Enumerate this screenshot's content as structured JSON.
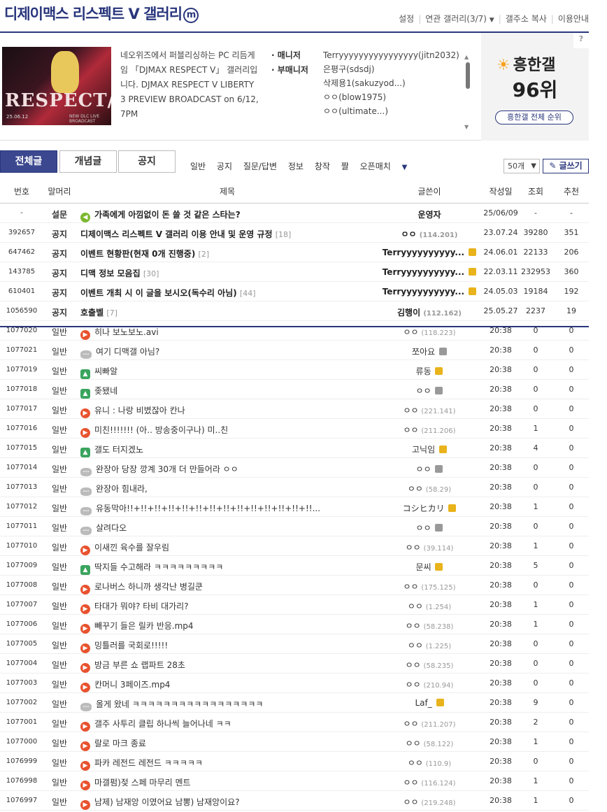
{
  "header": {
    "title": "디제이맥스 리스펙트 V 갤러리",
    "title_badge": "m",
    "links": [
      "설정",
      "연관 갤러리(3/7)",
      "갤주소 복사",
      "이용안내"
    ]
  },
  "info": {
    "thumb_text": "RESPECT/V",
    "thumb_small": "25.06.12",
    "thumb_small2": "NEW DLC LIVE BROADCAST",
    "desc": "네오위즈에서 퍼블리싱하는 PC 리듬게임 「DJMAX RESPECT V」 갤러리입니다. DJMAX RESPECT V LIBERTY 3 PREVIEW BROADCAST on 6/12, 7PM",
    "manager_label": "· 매니저",
    "submanager_label": "· 부매니저",
    "manager": "Terryyyyyyyyyyyyyyyy(jitn2032)",
    "submanagers": [
      "은평구(sdsdj)",
      "삭제용1(sakuzyod...)",
      "ㅇㅇ(blow1975)",
      "ㅇㅇ(ultimate...)"
    ]
  },
  "rank": {
    "help": "?",
    "label": "흥한갤",
    "value": "96위",
    "button": "흥한갤 전체 순위"
  },
  "tabs": [
    "전체글",
    "개념글",
    "공지"
  ],
  "heads": [
    "일반",
    "공지",
    "질문/답변",
    "정보",
    "창작",
    "짤",
    "오픈매치"
  ],
  "per_page": "50개",
  "write_button": "글쓰기",
  "columns": [
    "번호",
    "말머리",
    "제목",
    "글쓴이",
    "작성일",
    "조회",
    "추천"
  ],
  "rows": [
    {
      "num": "-",
      "head": "설문",
      "icon": "spk",
      "title": "가족에게 아낌없이 돈 쓸 것 같은 스타는?",
      "cnt": "",
      "writer": "운영자",
      "ip": "",
      "badge": "",
      "date": "25/06/09",
      "views": "-",
      "rec": "-",
      "notice": true
    },
    {
      "num": "392657",
      "head": "공지",
      "icon": "info",
      "title": "디제이맥스 리스펙트 V 갤러리 이용 안내 및 운영 규정",
      "cnt": "[18]",
      "writer": "ㅇㅇ",
      "ip": "(114.201)",
      "badge": "",
      "date": "23.07.24",
      "views": "39280",
      "rec": "351",
      "notice": true
    },
    {
      "num": "647462",
      "head": "공지",
      "icon": "info",
      "title": "이벤트 현황판(현재 0개 진행중)",
      "cnt": "[2]",
      "writer": "Terryyyyyyyyyy...",
      "ip": "",
      "badge": "lock",
      "date": "24.06.01",
      "views": "22133",
      "rec": "206",
      "notice": true
    },
    {
      "num": "143785",
      "head": "공지",
      "icon": "info",
      "title": "디맥 정보 모음집",
      "cnt": "[30]",
      "writer": "Terryyyyyyyyyy...",
      "ip": "",
      "badge": "lock",
      "date": "22.03.11",
      "views": "232953",
      "rec": "360",
      "notice": true
    },
    {
      "num": "610401",
      "head": "공지",
      "icon": "info",
      "title": "이벤트 개최 시 이 글을 보시오(독수리 아님)",
      "cnt": "[44]",
      "writer": "Terryyyyyyyyyy...",
      "ip": "",
      "badge": "lock",
      "date": "24.05.03",
      "views": "19184",
      "rec": "192",
      "notice": true
    },
    {
      "num": "1056590",
      "head": "공지",
      "icon": "info",
      "title": "호출벨",
      "cnt": "[7]",
      "writer": "김행이",
      "ip": "(112.162)",
      "badge": "",
      "date": "25.05.27",
      "views": "2237",
      "rec": "19",
      "notice": true
    },
    {
      "num": "1077020",
      "head": "일반",
      "icon": "vid",
      "title": "히나 보노보노.avi",
      "cnt": "",
      "writer": "ㅇㅇ",
      "ip": "(118.223)",
      "badge": "",
      "date": "20:38",
      "views": "0",
      "rec": "0"
    },
    {
      "num": "1077021",
      "head": "일반",
      "icon": "txt",
      "title": "여기 디맥갤 아님?",
      "cnt": "",
      "writer": "쪼아요",
      "ip": "",
      "badge": "fix",
      "date": "20:38",
      "views": "0",
      "rec": "0"
    },
    {
      "num": "1077019",
      "head": "일반",
      "icon": "img",
      "title": "씨빠알",
      "cnt": "",
      "writer": "류동",
      "ip": "",
      "badge": "lock",
      "date": "20:38",
      "views": "0",
      "rec": "0"
    },
    {
      "num": "1077018",
      "head": "일반",
      "icon": "img",
      "title": "좆됐네",
      "cnt": "",
      "writer": "ㅇㅇ",
      "ip": "",
      "badge": "fix",
      "date": "20:38",
      "views": "0",
      "rec": "0"
    },
    {
      "num": "1077017",
      "head": "일반",
      "icon": "vid",
      "title": "유니 : 나랑 비볐잖아 칸나",
      "cnt": "",
      "writer": "ㅇㅇ",
      "ip": "(221.141)",
      "badge": "",
      "date": "20:38",
      "views": "0",
      "rec": "0"
    },
    {
      "num": "1077016",
      "head": "일반",
      "icon": "vid",
      "title": "미친!!!!!!! (아.. 방송중이구나) 미..친",
      "cnt": "",
      "writer": "ㅇㅇ",
      "ip": "(211.206)",
      "badge": "",
      "date": "20:38",
      "views": "1",
      "rec": "0"
    },
    {
      "num": "1077015",
      "head": "일반",
      "icon": "img",
      "title": "갤도 터지겠노",
      "cnt": "",
      "writer": "고닉임",
      "ip": "",
      "badge": "lock",
      "date": "20:38",
      "views": "4",
      "rec": "0"
    },
    {
      "num": "1077014",
      "head": "일반",
      "icon": "txt",
      "title": "완장아 당장 깡계 30개 더 만들어라 ㅇㅇ",
      "cnt": "",
      "writer": "ㅇㅇ",
      "ip": "",
      "badge": "fix",
      "date": "20:38",
      "views": "0",
      "rec": "0"
    },
    {
      "num": "1077013",
      "head": "일반",
      "icon": "txt",
      "title": "완장아 힘내라,",
      "cnt": "",
      "writer": "ㅇㅇ",
      "ip": "(58.29)",
      "badge": "",
      "date": "20:38",
      "views": "0",
      "rec": "0"
    },
    {
      "num": "1077012",
      "head": "일반",
      "icon": "txt",
      "title": "유동막아!!+!!+!!+!!+!!+!!+!!+!!+!!+!!+!!+!!+!!+!!...",
      "cnt": "",
      "writer": "コシヒカリ",
      "ip": "",
      "badge": "lock",
      "date": "20:38",
      "views": "1",
      "rec": "0"
    },
    {
      "num": "1077011",
      "head": "일반",
      "icon": "txt",
      "title": "살려다오",
      "cnt": "",
      "writer": "ㅇㅇ",
      "ip": "",
      "badge": "fix",
      "date": "20:38",
      "views": "0",
      "rec": "0"
    },
    {
      "num": "1077010",
      "head": "일반",
      "icon": "vid",
      "title": "이새낀 육수를 잘우림",
      "cnt": "",
      "writer": "ㅇㅇ",
      "ip": "(39.114)",
      "badge": "",
      "date": "20:38",
      "views": "1",
      "rec": "0"
    },
    {
      "num": "1077009",
      "head": "일반",
      "icon": "img",
      "title": "딱지들 수고해라 ㅋㅋㅋㅋㅋㅋㅋㅋㅋ",
      "cnt": "",
      "writer": "문씨",
      "ip": "",
      "badge": "lock",
      "date": "20:38",
      "views": "5",
      "rec": "0"
    },
    {
      "num": "1077008",
      "head": "일반",
      "icon": "vid",
      "title": "로나버스 하니까 생각난 병길쿤",
      "cnt": "",
      "writer": "ㅇㅇ",
      "ip": "(175.125)",
      "badge": "",
      "date": "20:38",
      "views": "0",
      "rec": "0"
    },
    {
      "num": "1077007",
      "head": "일반",
      "icon": "vid",
      "title": "타대가 뭐야? 타비 대가리?",
      "cnt": "",
      "writer": "ㅇㅇ",
      "ip": "(1.254)",
      "badge": "",
      "date": "20:38",
      "views": "1",
      "rec": "0"
    },
    {
      "num": "1077006",
      "head": "일반",
      "icon": "vid",
      "title": "빼꾸기 들은 릴카 반응.mp4",
      "cnt": "",
      "writer": "ㅇㅇ",
      "ip": "(58.238)",
      "badge": "",
      "date": "20:38",
      "views": "1",
      "rec": "0"
    },
    {
      "num": "1077005",
      "head": "일반",
      "icon": "vid",
      "title": "밍틀러를 국회로!!!!!",
      "cnt": "",
      "writer": "ㅇㅇ",
      "ip": "(1.225)",
      "badge": "",
      "date": "20:38",
      "views": "0",
      "rec": "0"
    },
    {
      "num": "1077004",
      "head": "일반",
      "icon": "vid",
      "title": "방금 부른 쇼 랩파트 28초",
      "cnt": "",
      "writer": "ㅇㅇ",
      "ip": "(58.235)",
      "badge": "",
      "date": "20:38",
      "views": "0",
      "rec": "0"
    },
    {
      "num": "1077003",
      "head": "일반",
      "icon": "vid",
      "title": "칸머니 3페이즈.mp4",
      "cnt": "",
      "writer": "ㅇㅇ",
      "ip": "(210.94)",
      "badge": "",
      "date": "20:38",
      "views": "0",
      "rec": "0"
    },
    {
      "num": "1077002",
      "head": "일반",
      "icon": "txt",
      "title": "올게 왔네 ㅋㅋㅋㅋㅋㅋㅋㅋㅋㅋㅋㅋㅋㅋㅋㅋㅋ",
      "cnt": "",
      "writer": "Laf_",
      "ip": "",
      "badge": "lock",
      "date": "20:38",
      "views": "9",
      "rec": "0"
    },
    {
      "num": "1077001",
      "head": "일반",
      "icon": "vid",
      "title": "갤주 사투리 클립 하나씩 늘어나네 ㅋㅋ",
      "cnt": "",
      "writer": "ㅇㅇ",
      "ip": "(211.207)",
      "badge": "",
      "date": "20:38",
      "views": "2",
      "rec": "0"
    },
    {
      "num": "1077000",
      "head": "일반",
      "icon": "vid",
      "title": "랄로 마크 종료",
      "cnt": "",
      "writer": "ㅇㅇ",
      "ip": "(58.122)",
      "badge": "",
      "date": "20:38",
      "views": "1",
      "rec": "0"
    },
    {
      "num": "1076999",
      "head": "일반",
      "icon": "vid",
      "title": "파카 레전드 레전드 ㅋㅋㅋㅋㅋ",
      "cnt": "",
      "writer": "ㅇㅇ",
      "ip": "(110.9)",
      "badge": "",
      "date": "20:38",
      "views": "0",
      "rec": "0"
    },
    {
      "num": "1076998",
      "head": "일반",
      "icon": "vid",
      "title": "마갤펌)젖 스페 마무리 멘트",
      "cnt": "",
      "writer": "ㅇㅇ",
      "ip": "(116.124)",
      "badge": "",
      "date": "20:38",
      "views": "1",
      "rec": "0"
    },
    {
      "num": "1076997",
      "head": "일반",
      "icon": "vid",
      "title": "남제) 남재앙 이였어요 남뽕) 남재앙이요?",
      "cnt": "",
      "writer": "ㅇㅇ",
      "ip": "(219.248)",
      "badge": "",
      "date": "20:38",
      "views": "1",
      "rec": "0"
    }
  ]
}
